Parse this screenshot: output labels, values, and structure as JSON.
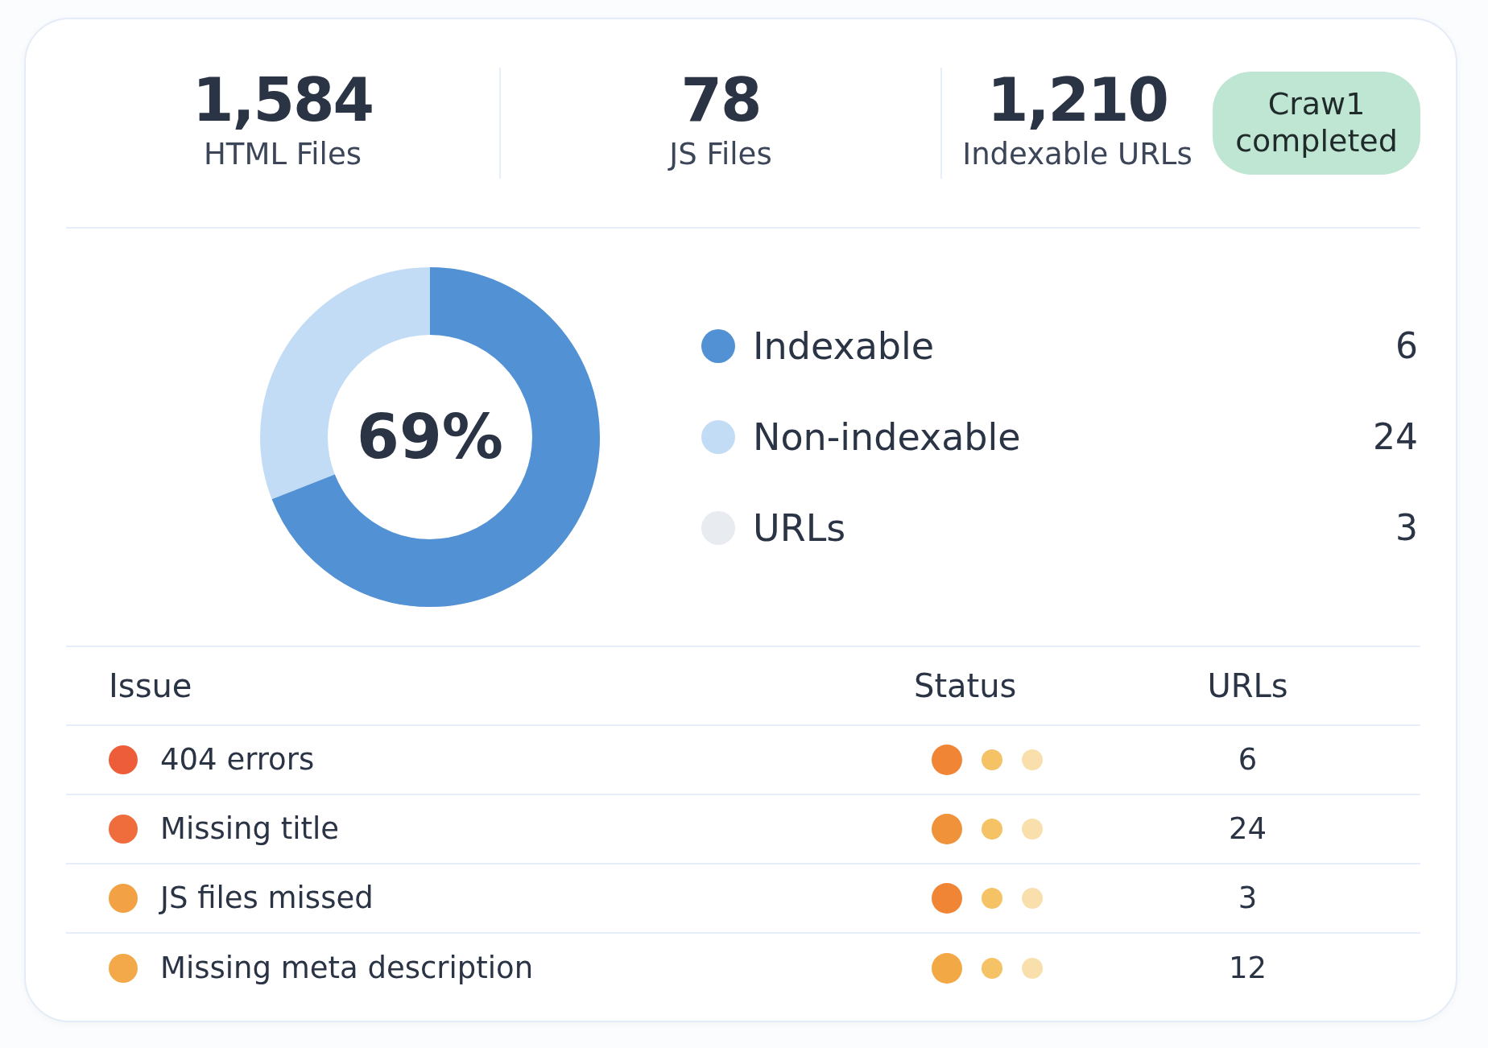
{
  "stats": [
    {
      "value": "1,584",
      "label": "HTML Files"
    },
    {
      "value": "78",
      "label": "JS Files"
    },
    {
      "value": "1,210",
      "label": "Indexable URLs"
    }
  ],
  "badge": "Craw1 completed",
  "donut": {
    "center_label": "69%",
    "level": 0.69
  },
  "legend": [
    {
      "label": "Indexable",
      "count": "6",
      "color": "#5291d3"
    },
    {
      "label": "Non-indexable",
      "count": "24",
      "color": "#c2dcf5"
    },
    {
      "label": "URLs",
      "count": "3",
      "color": "#e8ebf0"
    }
  ],
  "table": {
    "columns": [
      "Issue",
      "Status",
      "URLs"
    ],
    "rows": [
      {
        "issue": "404 errors",
        "color": "#ee5d3a",
        "status": [
          {
            "color": "#ef8535"
          },
          {
            "color": "#f5c266"
          },
          {
            "color": "#f9dfab"
          }
        ],
        "urls": "6"
      },
      {
        "issue": "Missing title",
        "color": "#ef6c3c",
        "status": [
          {
            "color": "#f0923a"
          },
          {
            "color": "#f5c266"
          },
          {
            "color": "#f9dfab"
          }
        ],
        "urls": "24"
      },
      {
        "issue": "JS files missed",
        "color": "#f2a244",
        "status": [
          {
            "color": "#ef8535"
          },
          {
            "color": "#f5c266"
          },
          {
            "color": "#f9dfab"
          }
        ],
        "urls": "3"
      },
      {
        "issue": "Missing meta description",
        "color": "#f3a94a",
        "status": [
          {
            "color": "#f2a845"
          },
          {
            "color": "#f5c266"
          },
          {
            "color": "#f9dfab"
          }
        ],
        "urls": "12"
      }
    ]
  }
}
